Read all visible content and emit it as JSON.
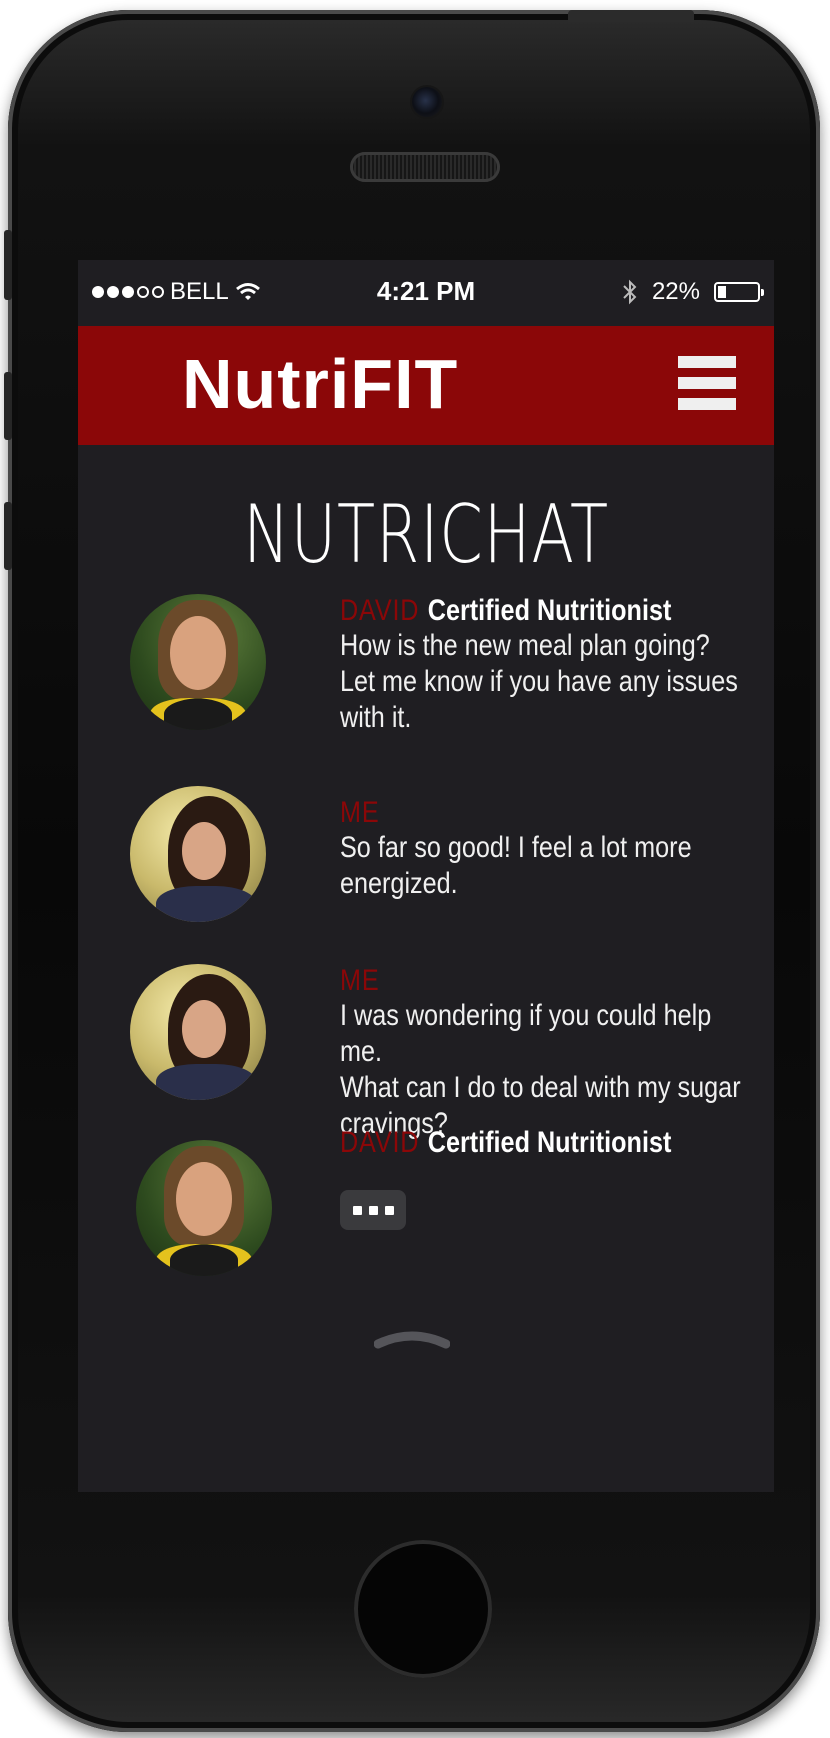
{
  "status_bar": {
    "carrier": "BELL",
    "signal_on": 3,
    "signal_total": 5,
    "time": "4:21 PM",
    "battery_percent_label": "22%",
    "battery_level": 0.22
  },
  "header": {
    "brand": "NutriFIT",
    "menu_icon": "hamburger-menu-icon"
  },
  "page": {
    "title": "NUTRICHAT"
  },
  "messages": [
    {
      "sender": "DAVID",
      "role": "Certified Nutritionist",
      "lines": [
        "How is the new meal plan going?",
        "Let me know if you have any issues",
        "with it."
      ]
    },
    {
      "sender": "ME",
      "role": "",
      "lines": [
        "So far so good! I feel a lot more",
        "energized."
      ]
    },
    {
      "sender": "ME",
      "role": "",
      "lines": [
        "I was wondering if you could help me.",
        "What can I do to deal with my sugar",
        "cravings?"
      ]
    },
    {
      "sender": "DAVID",
      "role": "Certified Nutritionist",
      "typing_indicator": "typing-dots-icon"
    }
  ],
  "footer": {
    "handle_icon": "chevron-up-icon"
  },
  "colors": {
    "brand_red": "#8b0708",
    "screen_bg": "#1f1e22",
    "typing_bubble": "#3a3a3d"
  }
}
